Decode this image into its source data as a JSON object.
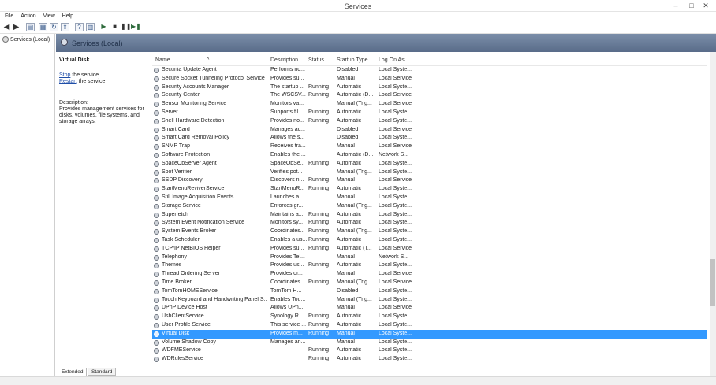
{
  "window": {
    "title": "Services",
    "minimize": "–",
    "maximize": "□",
    "close": "✕"
  },
  "menu": [
    "File",
    "Action",
    "View",
    "Help"
  ],
  "toolbar": {
    "icons": [
      "back-arrow-icon",
      "forward-arrow-icon",
      "show-hide-console-tree-icon",
      "properties-icon",
      "refresh-icon",
      "export-list-icon",
      "help-icon",
      "show-action-pane-icon",
      "start-service-icon",
      "stop-service-icon",
      "pause-service-icon",
      "restart-service-icon"
    ]
  },
  "tree": {
    "item": "Services (Local)"
  },
  "header": {
    "title": "Services (Local)"
  },
  "details": {
    "service_name": "Virtual Disk",
    "stop_link": "Stop",
    "stop_suffix": " the service",
    "restart_link": "Restart",
    "restart_suffix": " the service",
    "description_label": "Description:",
    "description_text": "Provides management services for disks, volumes, file systems, and storage arrays."
  },
  "columns": [
    "Name",
    "Description",
    "Status",
    "Startup Type",
    "Log On As"
  ],
  "selected_row": "Virtual Disk",
  "services": [
    [
      "Secunia Update Agent",
      "Performs no...",
      "",
      "Disabled",
      "Local Syste..."
    ],
    [
      "Secure Socket Tunneling Protocol Service",
      "Provides su...",
      "",
      "Manual",
      "Local Service"
    ],
    [
      "Security Accounts Manager",
      "The startup ...",
      "Running",
      "Automatic",
      "Local Syste..."
    ],
    [
      "Security Center",
      "The WSCSV...",
      "Running",
      "Automatic (D...",
      "Local Service"
    ],
    [
      "Sensor Monitoring Service",
      "Monitors va...",
      "",
      "Manual (Trig...",
      "Local Service"
    ],
    [
      "Server",
      "Supports fil...",
      "Running",
      "Automatic",
      "Local Syste..."
    ],
    [
      "Shell Hardware Detection",
      "Provides no...",
      "Running",
      "Automatic",
      "Local Syste..."
    ],
    [
      "Smart Card",
      "Manages ac...",
      "",
      "Disabled",
      "Local Service"
    ],
    [
      "Smart Card Removal Policy",
      "Allows the s...",
      "",
      "Disabled",
      "Local Syste..."
    ],
    [
      "SNMP Trap",
      "Receives tra...",
      "",
      "Manual",
      "Local Service"
    ],
    [
      "Software Protection",
      "Enables the ...",
      "",
      "Automatic (D...",
      "Network S..."
    ],
    [
      "SpaceObServer Agent",
      "SpaceObSe...",
      "Running",
      "Automatic",
      "Local Syste..."
    ],
    [
      "Spot Verifier",
      "Verifies pot...",
      "",
      "Manual (Trig...",
      "Local Syste..."
    ],
    [
      "SSDP Discovery",
      "Discovers n...",
      "Running",
      "Manual",
      "Local Service"
    ],
    [
      "StartMenuReviverService",
      "StartMenuR...",
      "Running",
      "Automatic",
      "Local Syste..."
    ],
    [
      "Still Image Acquisition Events",
      "Launches a...",
      "",
      "Manual",
      "Local Syste..."
    ],
    [
      "Storage Service",
      "Enforces gr...",
      "",
      "Manual (Trig...",
      "Local Syste..."
    ],
    [
      "Superfetch",
      "Maintains a...",
      "Running",
      "Automatic",
      "Local Syste..."
    ],
    [
      "System Event Notification Service",
      "Monitors sy...",
      "Running",
      "Automatic",
      "Local Syste..."
    ],
    [
      "System Events Broker",
      "Coordinates...",
      "Running",
      "Manual (Trig...",
      "Local Syste..."
    ],
    [
      "Task Scheduler",
      "Enables a us...",
      "Running",
      "Automatic",
      "Local Syste..."
    ],
    [
      "TCP/IP NetBIOS Helper",
      "Provides su...",
      "Running",
      "Automatic (T...",
      "Local Service"
    ],
    [
      "Telephony",
      "Provides Tel...",
      "",
      "Manual",
      "Network S..."
    ],
    [
      "Themes",
      "Provides us...",
      "Running",
      "Automatic",
      "Local Syste..."
    ],
    [
      "Thread Ordering Server",
      "Provides or...",
      "",
      "Manual",
      "Local Service"
    ],
    [
      "Time Broker",
      "Coordinates...",
      "Running",
      "Manual (Trig...",
      "Local Service"
    ],
    [
      "TomTomHOMEService",
      "TomTom H...",
      "",
      "Disabled",
      "Local Syste..."
    ],
    [
      "Touch Keyboard and Handwriting Panel S...",
      "Enables Tou...",
      "",
      "Manual (Trig...",
      "Local Syste..."
    ],
    [
      "UPnP Device Host",
      "Allows UPn...",
      "",
      "Manual",
      "Local Service"
    ],
    [
      "UsbClientService",
      "Synology R...",
      "Running",
      "Automatic",
      "Local Syste..."
    ],
    [
      "User Profile Service",
      "This service ...",
      "Running",
      "Automatic",
      "Local Syste..."
    ],
    [
      "Virtual Disk",
      "Provides m...",
      "Running",
      "Manual",
      "Local Syste..."
    ],
    [
      "Volume Shadow Copy",
      "Manages an...",
      "",
      "Manual",
      "Local Syste..."
    ],
    [
      "WDFMEService",
      "",
      "Running",
      "Automatic",
      "Local Syste..."
    ],
    [
      "WDRulesService",
      "",
      "Running",
      "Automatic",
      "Local Syste..."
    ]
  ],
  "tabs": [
    "Extended",
    "Standard"
  ],
  "active_tab": "Extended",
  "colors": {
    "selection": "#3399ff",
    "header_band": "#6b7f9b",
    "link": "#1f4ea8"
  }
}
